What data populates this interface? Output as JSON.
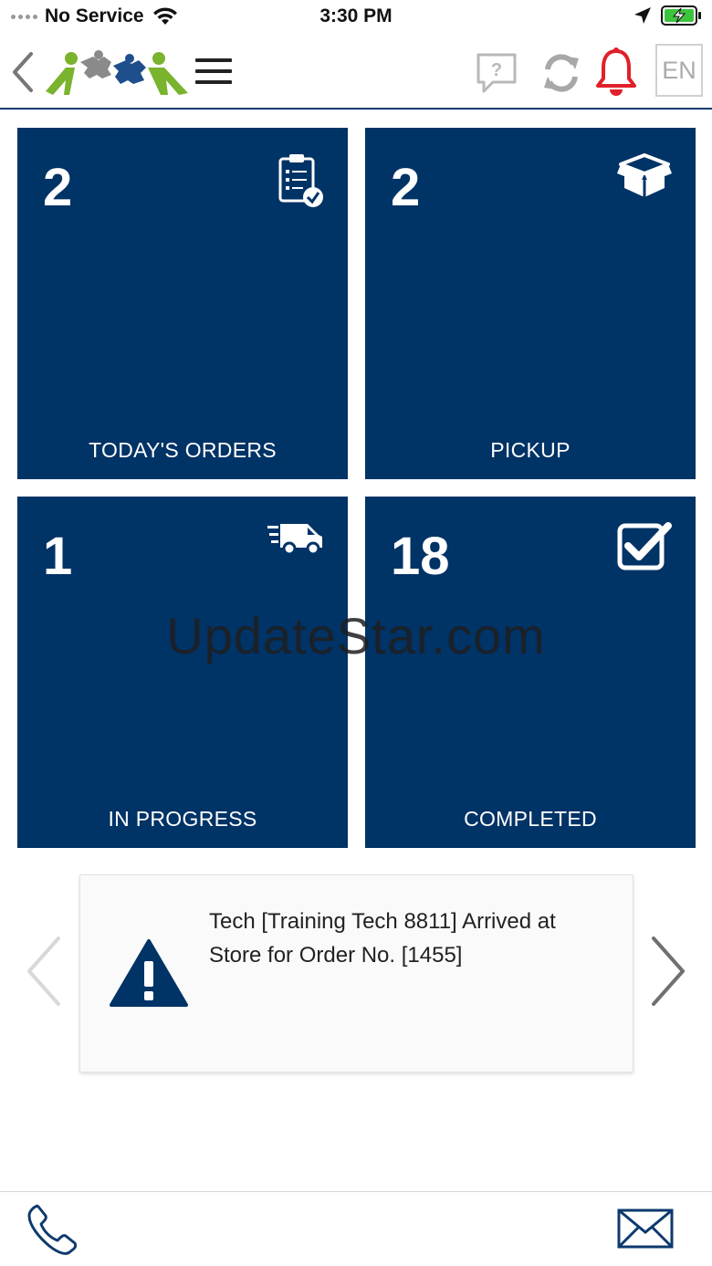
{
  "status_bar": {
    "carrier": "No Service",
    "time": "3:30 PM"
  },
  "header": {
    "language": "EN",
    "help_glyph": "?"
  },
  "tiles": [
    {
      "count": "2",
      "label": "TODAY'S ORDERS",
      "icon": "clipboard-check-icon"
    },
    {
      "count": "2",
      "label": "PICKUP",
      "icon": "open-box-icon"
    },
    {
      "count": "1",
      "label": "IN PROGRESS",
      "icon": "delivery-truck-icon"
    },
    {
      "count": "18",
      "label": "COMPLETED",
      "icon": "checkbox-icon"
    }
  ],
  "watermark": "UpdateStar.com",
  "notification": {
    "message": "Tech [Training Tech 8811] Arrived at Store for Order No. [1455]",
    "icon": "warning-icon"
  },
  "colors": {
    "tile_background": "#003366",
    "alert_bell": "#e0202a",
    "logo_green": "#7ab32e",
    "logo_blue": "#1f4e8c"
  }
}
